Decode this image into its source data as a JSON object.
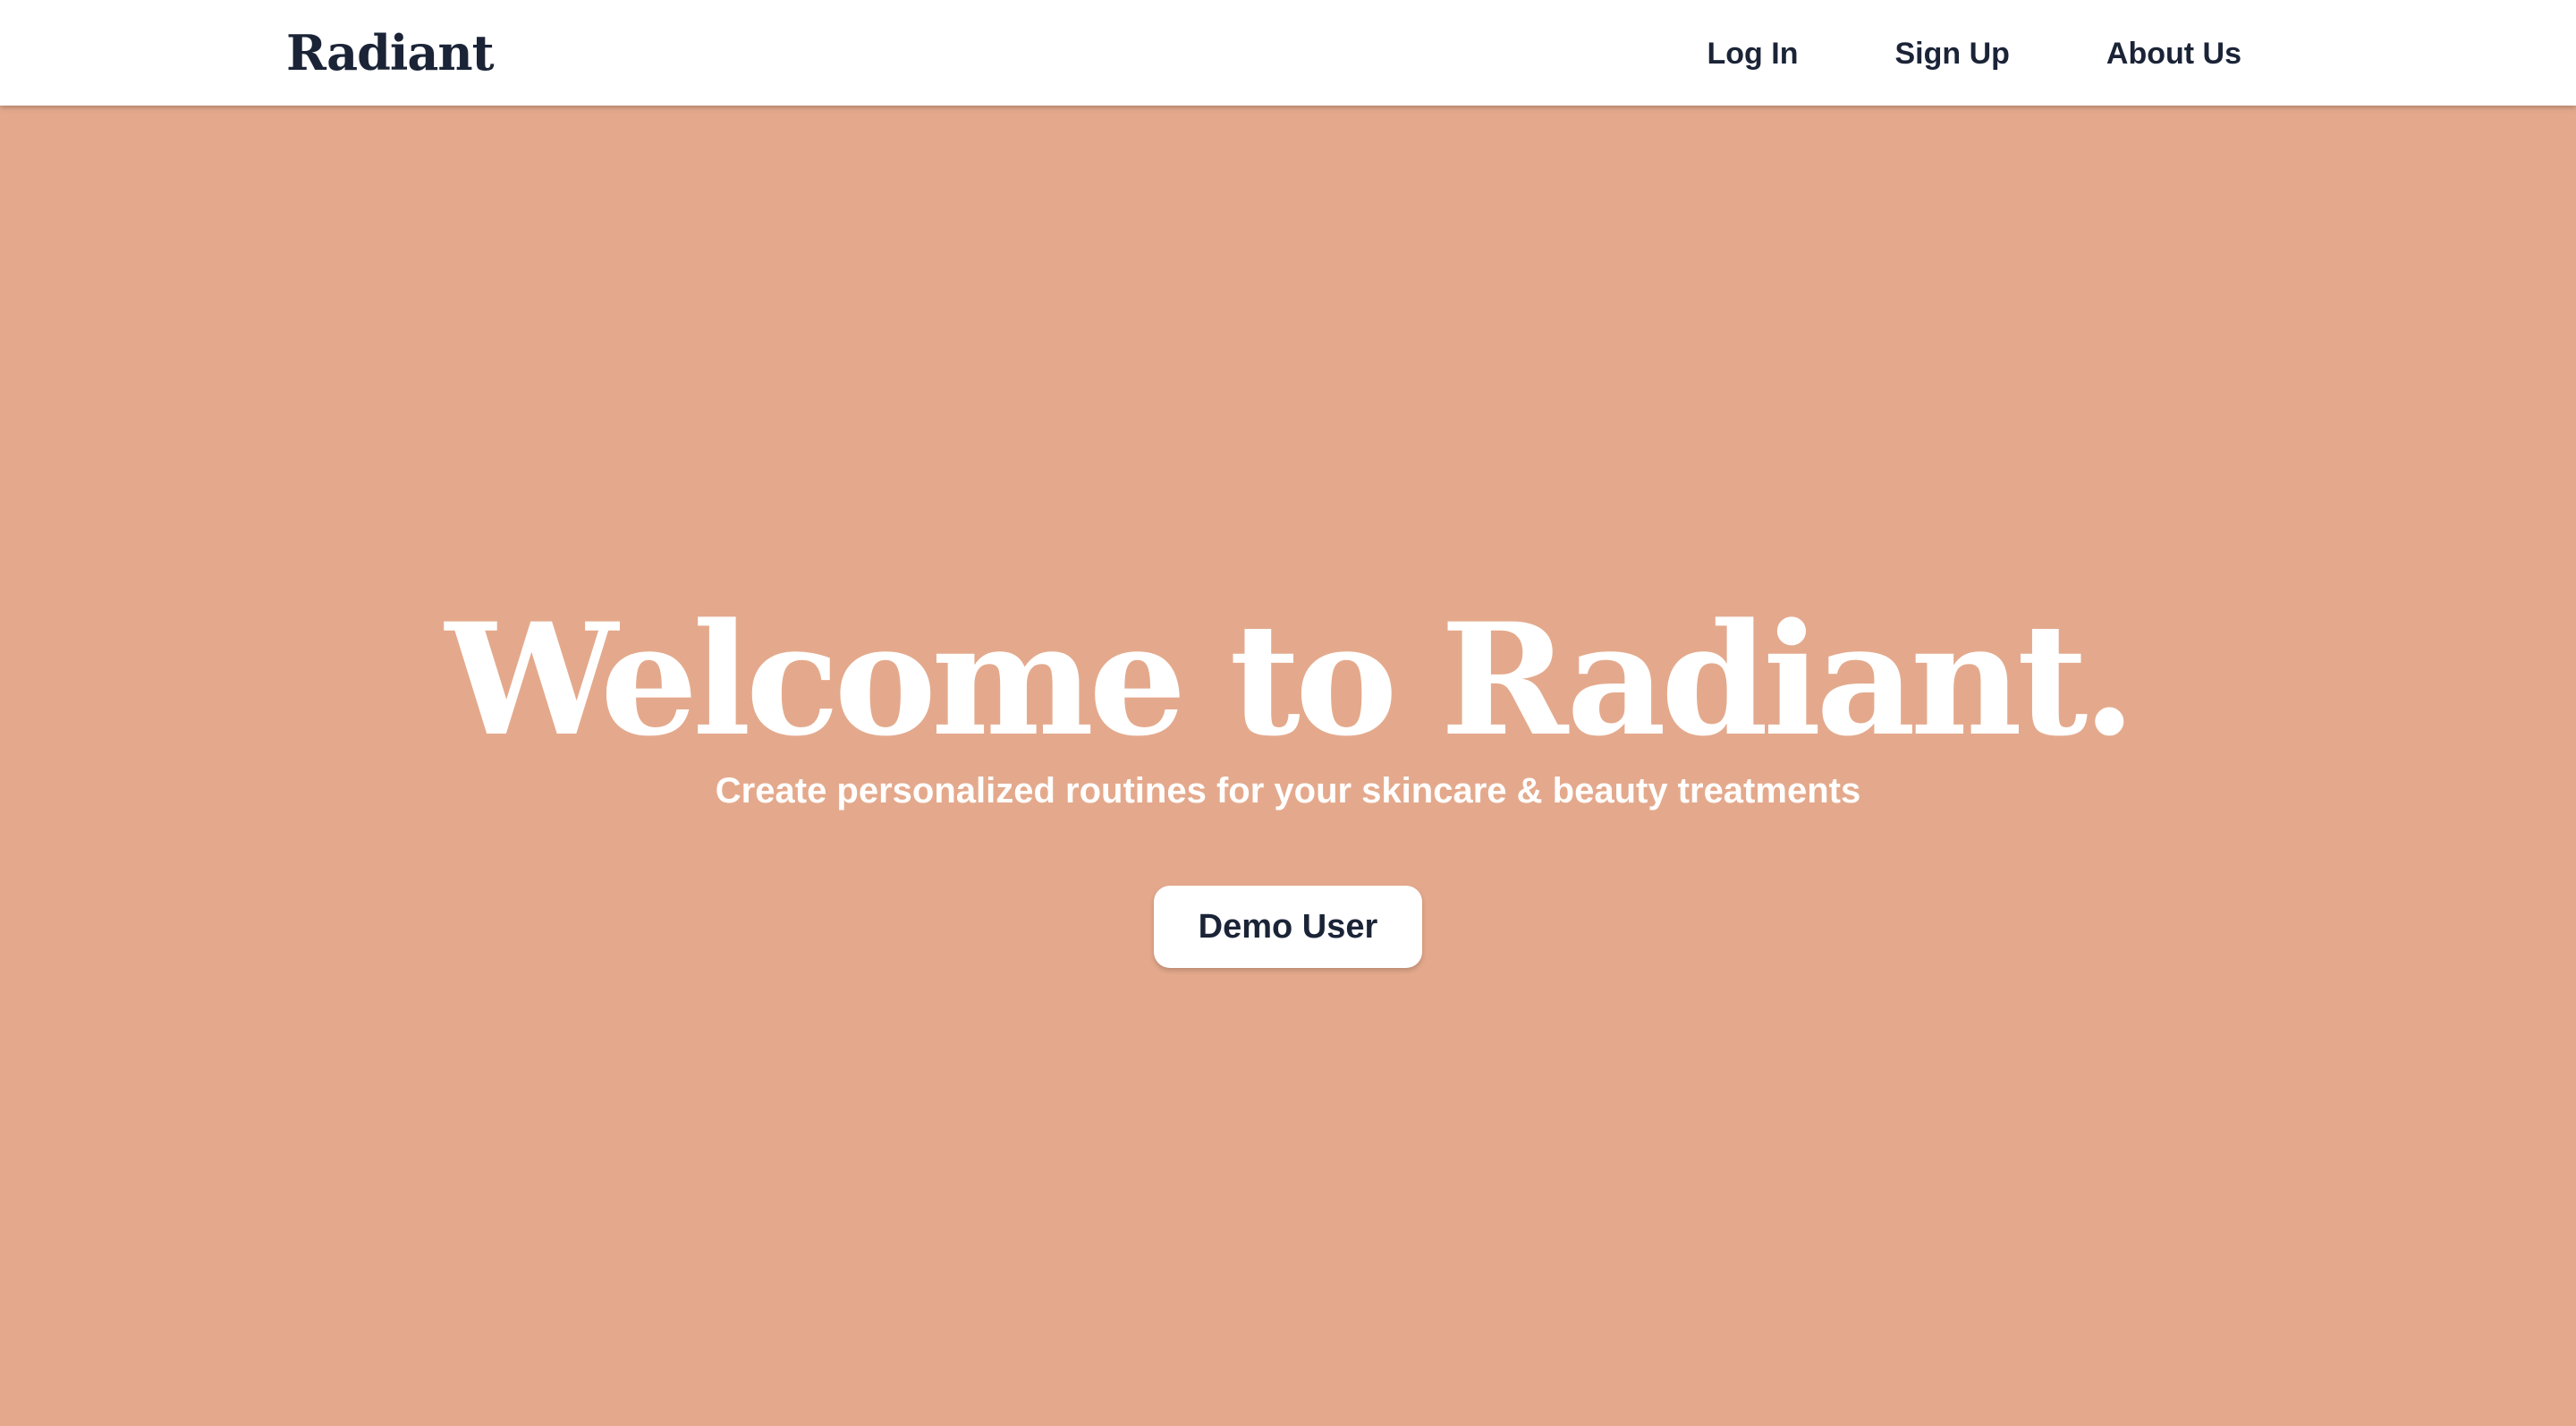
{
  "navbar": {
    "brand": "Radiant",
    "links": [
      {
        "label": "Log In"
      },
      {
        "label": "Sign Up"
      },
      {
        "label": "About Us"
      }
    ]
  },
  "hero": {
    "title": "Welcome to Radiant.",
    "subtitle": "Create personalized routines for your skincare & beauty treatments",
    "demo_button_label": "Demo User"
  },
  "colors": {
    "background": "#e4a98c",
    "navbar_background": "#ffffff",
    "text_dark": "#1b2437",
    "text_light": "#ffffff"
  }
}
